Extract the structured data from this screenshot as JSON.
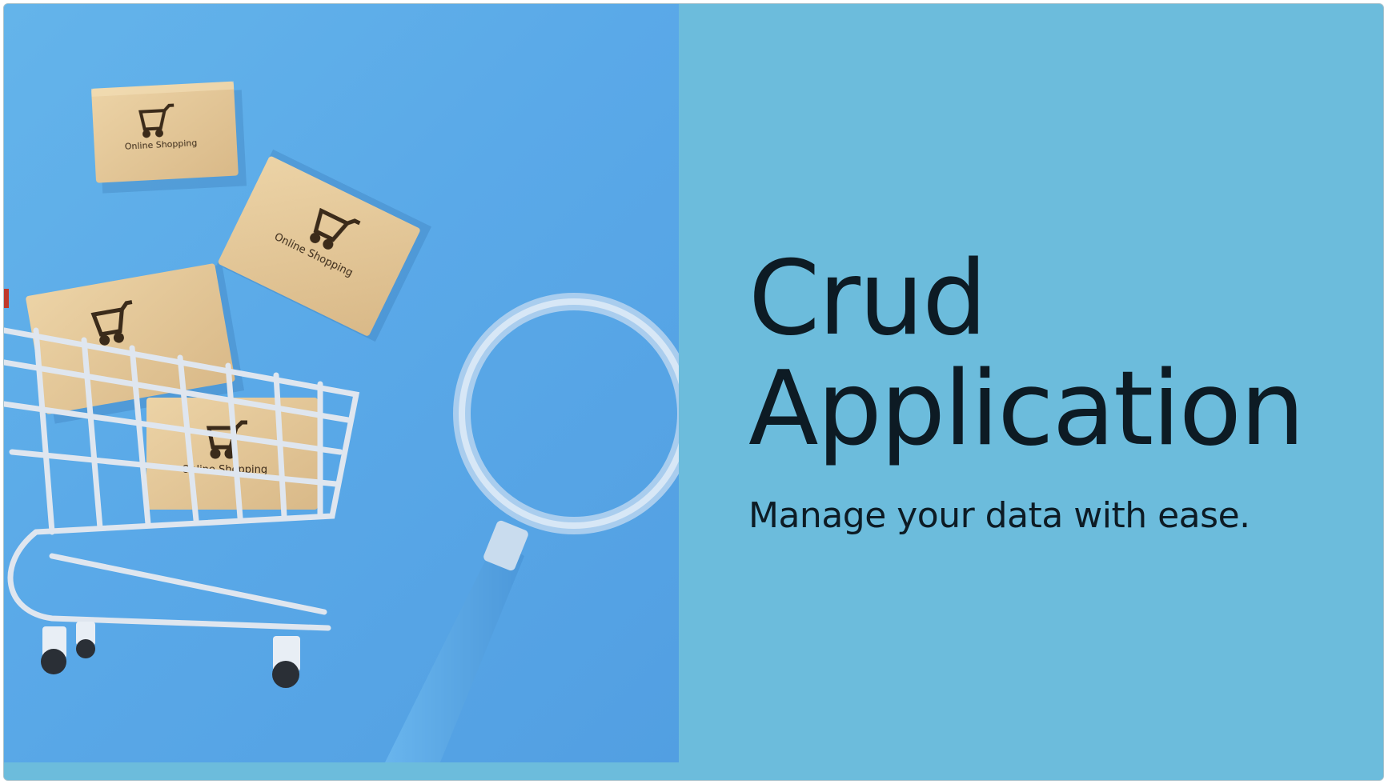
{
  "slide": {
    "title_line_1": "Crud",
    "title_line_2": "Application",
    "subtitle": "Manage your data with ease."
  },
  "hero_image": {
    "box_label": "Online Shopping",
    "icon": "cart-icon"
  },
  "colors": {
    "panel_background": "#6cbcdc",
    "image_background": "#5aa9e8",
    "text": "#0d1b24",
    "box": "#e6c99a"
  }
}
